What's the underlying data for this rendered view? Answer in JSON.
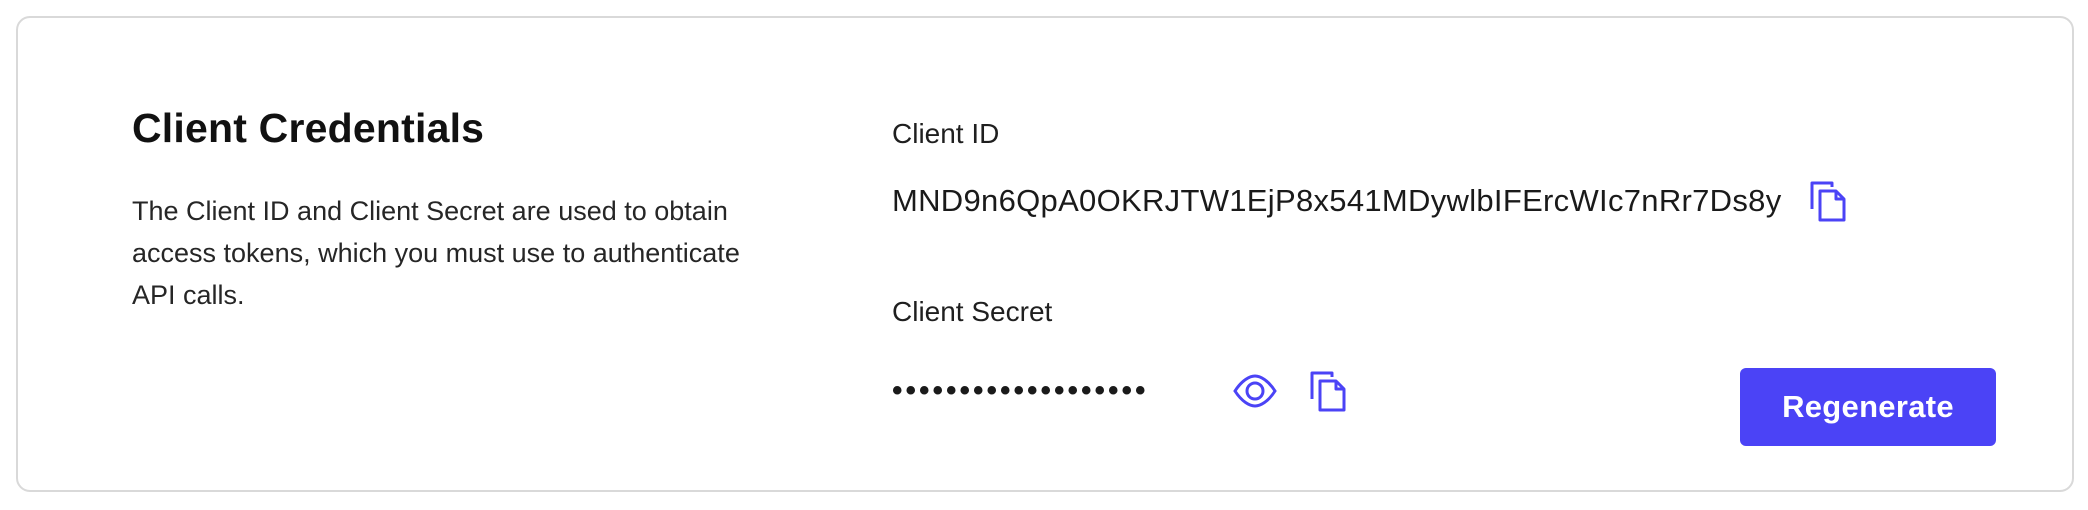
{
  "section": {
    "title": "Client Credentials",
    "description": "The Client ID and Client Secret are used to obtain access tokens, which you must use to authenticate API calls."
  },
  "client_id": {
    "label": "Client ID",
    "value": "MND9n6QpA0OKRJTW1EjP8x541MDywlbIFErcWIc7nRr7Ds8y",
    "copy_icon": "copy-icon"
  },
  "client_secret": {
    "label": "Client Secret",
    "masked_value": "•••••••••••••••••••",
    "reveal_icon": "eye-icon",
    "copy_icon": "copy-icon"
  },
  "actions": {
    "regenerate_label": "Regenerate"
  },
  "colors": {
    "accent": "#4b43f6",
    "border": "#d9d9d9",
    "text": "#1f1f1f"
  }
}
